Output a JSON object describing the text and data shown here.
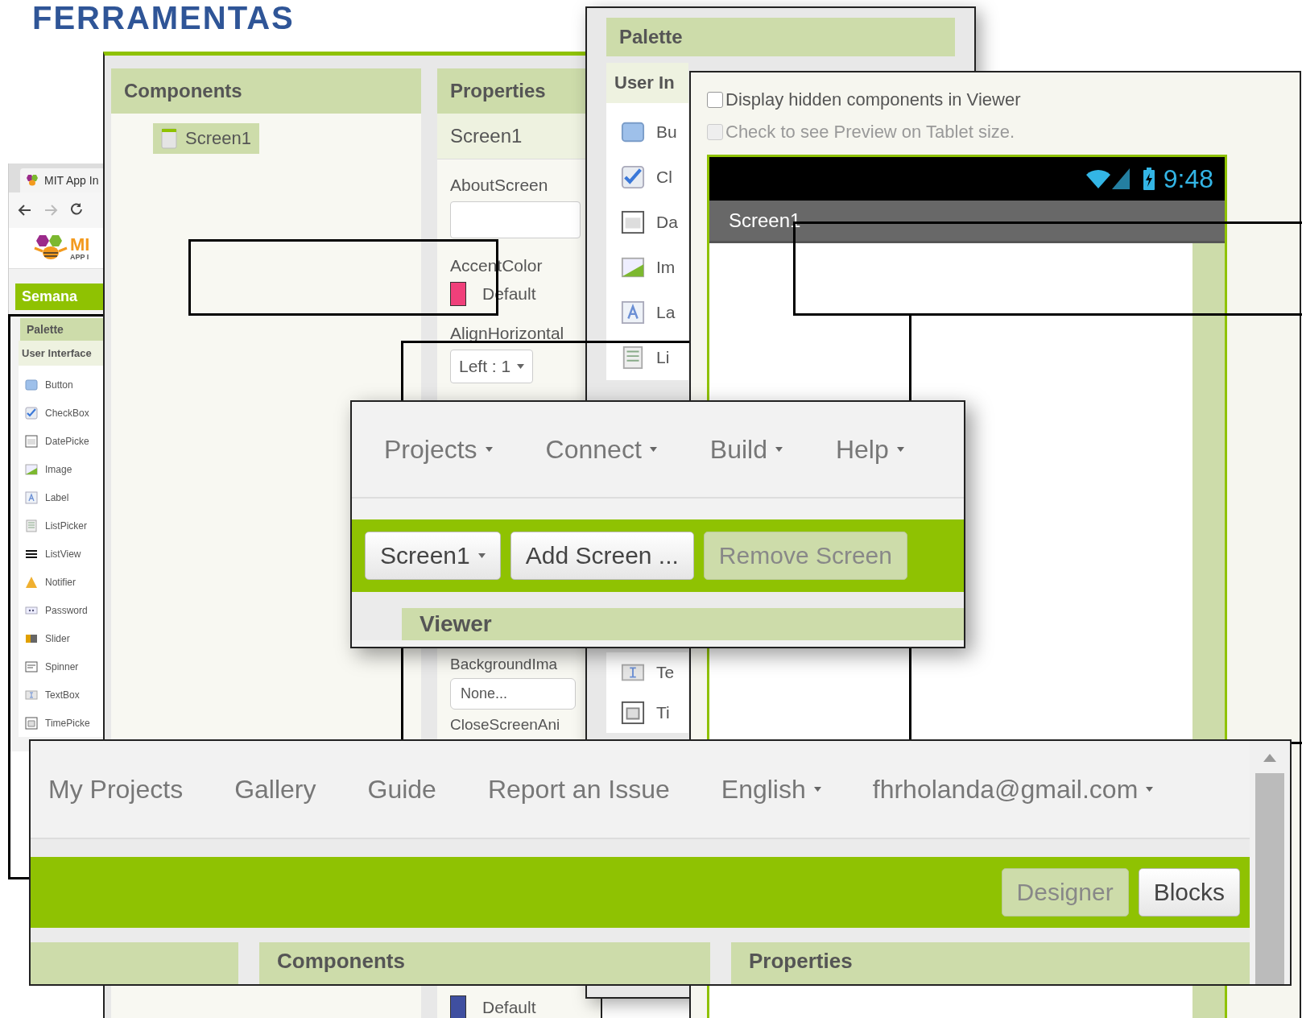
{
  "slide_title": "FERRAMENTAS",
  "browser": {
    "tab_title": "MIT App In",
    "logo_text": "MI",
    "logo_subtext": "APP I",
    "project_name": "Semana",
    "palette_title": "Palette",
    "category": "User Interface",
    "items": [
      {
        "label": "Button",
        "kind": "button"
      },
      {
        "label": "CheckBox",
        "kind": "checkbox"
      },
      {
        "label": "DatePicke",
        "kind": "datepicker"
      },
      {
        "label": "Image",
        "kind": "image"
      },
      {
        "label": "Label",
        "kind": "label"
      },
      {
        "label": "ListPicker",
        "kind": "listpicker"
      },
      {
        "label": "ListView",
        "kind": "listview"
      },
      {
        "label": "Notifier",
        "kind": "notifier"
      },
      {
        "label": "Password",
        "kind": "password"
      },
      {
        "label": "Slider",
        "kind": "slider"
      },
      {
        "label": "Spinner",
        "kind": "spinner"
      },
      {
        "label": "TextBox",
        "kind": "textbox"
      },
      {
        "label": "TimePicke",
        "kind": "timepicker"
      }
    ]
  },
  "designer": {
    "components_title": "Components",
    "tree": [
      {
        "label": "Screen1",
        "selected": true
      }
    ],
    "properties_title": "Properties",
    "component": "Screen1",
    "upper": [
      {
        "kind": "text",
        "label": "AboutScreen"
      },
      {
        "kind": "color",
        "label": "AccentColor",
        "value": "Default",
        "color": "#f0407a"
      },
      {
        "kind": "dropdown",
        "label": "AlignHorizontal",
        "value": "Left : 1"
      }
    ],
    "lower": [
      {
        "kind": "file",
        "label": "BackgroundIma",
        "value": "None..."
      },
      {
        "kind": "label",
        "label": "CloseScreenAni"
      }
    ],
    "bottom": [
      {
        "kind": "color",
        "value": "Default",
        "color": "#3f4fa0"
      }
    ]
  },
  "palette": {
    "title": "Palette",
    "category": "User In",
    "upper": [
      {
        "label": "Bu",
        "kind": "button"
      },
      {
        "label": "Cl",
        "kind": "checkbox"
      },
      {
        "label": "Da",
        "kind": "datepicker"
      },
      {
        "label": "Im",
        "kind": "image"
      },
      {
        "label": "La",
        "kind": "label"
      },
      {
        "label": "Li",
        "kind": "listpicker"
      }
    ],
    "lower": [
      {
        "label": "Te",
        "kind": "textbox"
      },
      {
        "label": "Ti",
        "kind": "timepicker"
      }
    ]
  },
  "viewer": {
    "options": [
      {
        "label": "Display hidden components in Viewer",
        "checked": false,
        "disabled": false
      },
      {
        "label": "Check to see Preview on Tablet size.",
        "checked": false,
        "disabled": true
      }
    ],
    "time": "9:48",
    "screen_title": "Screen1"
  },
  "project_bar": {
    "menu": [
      {
        "label": "Projects",
        "dropdown": true
      },
      {
        "label": "Connect",
        "dropdown": true
      },
      {
        "label": "Build",
        "dropdown": true
      },
      {
        "label": "Help",
        "dropdown": true
      }
    ],
    "screen_buttons": [
      {
        "label": "Screen1",
        "dropdown": true,
        "disabled": false
      },
      {
        "label": "Add Screen ...",
        "dropdown": false,
        "disabled": false
      },
      {
        "label": "Remove Screen",
        "dropdown": false,
        "disabled": true
      }
    ],
    "viewer_title": "Viewer"
  },
  "top_bar": {
    "menu": [
      {
        "label": "My Projects",
        "dropdown": false
      },
      {
        "label": "Gallery",
        "dropdown": false
      },
      {
        "label": "Guide",
        "dropdown": false
      },
      {
        "label": "Report an Issue",
        "dropdown": false
      },
      {
        "label": "English",
        "dropdown": true
      },
      {
        "label": "fhrholanda@gmail.com",
        "dropdown": true
      }
    ],
    "mode_buttons": [
      {
        "label": "Designer",
        "selected": true
      },
      {
        "label": "Blocks",
        "selected": false
      }
    ],
    "headers": [
      "Components",
      "Properties"
    ]
  }
}
